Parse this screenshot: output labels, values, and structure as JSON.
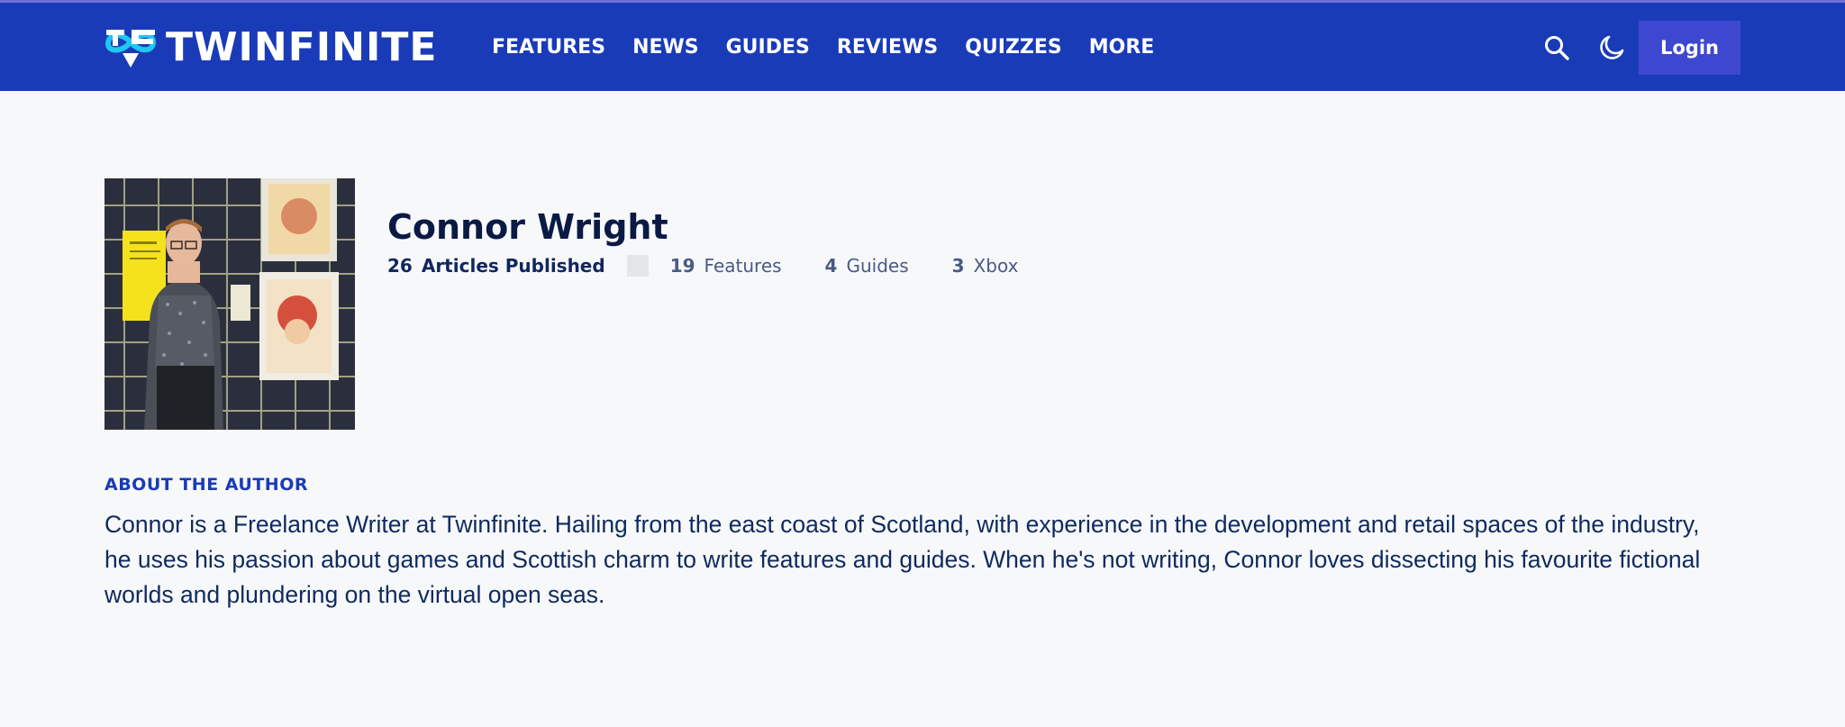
{
  "header": {
    "logo_text": "TWINFINITE",
    "nav": [
      "FEATURES",
      "NEWS",
      "GUIDES",
      "REVIEWS",
      "QUIZZES",
      "MORE"
    ],
    "login_label": "Login",
    "icons": [
      "search-icon",
      "moon-icon"
    ],
    "background_color": "#1a3bb8",
    "login_color": "#3e47d0",
    "logo_accent": "#1ec8f0"
  },
  "author": {
    "name": "Connor Wright",
    "articles_count": "26",
    "articles_label": "Articles Published",
    "stats": [
      {
        "count": "19",
        "label": "Features"
      },
      {
        "count": "4",
        "label": "Guides"
      },
      {
        "count": "3",
        "label": "Xbox"
      }
    ]
  },
  "about": {
    "heading": "ABOUT THE AUTHOR",
    "bio": "Connor is a Freelance Writer at Twinfinite. Hailing from the east coast of Scotland, with experience in the development and retail spaces of the industry, he uses his passion about games and Scottish charm to write features and guides. When he's not writing, Connor loves dissecting his favourite fictional worlds and plundering on the virtual open seas."
  }
}
